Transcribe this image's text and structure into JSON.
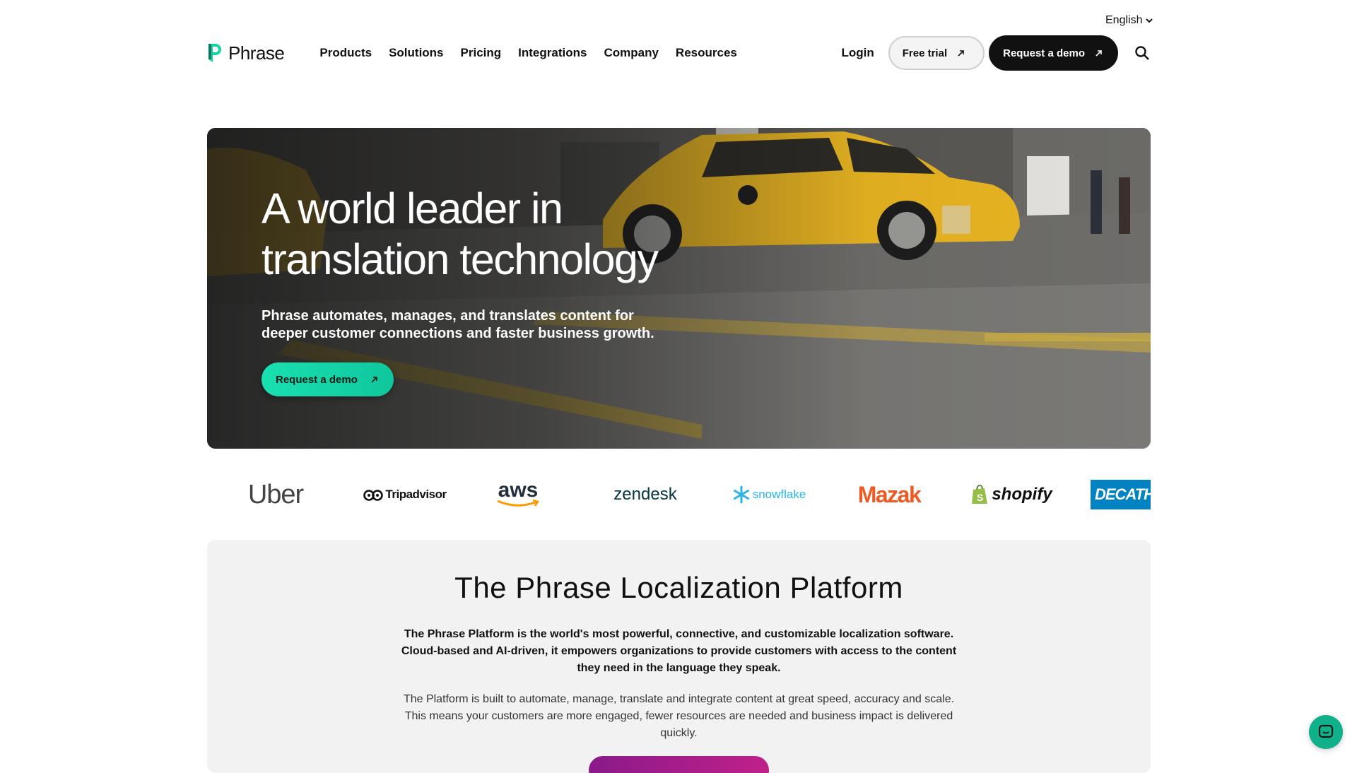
{
  "header": {
    "language": "English",
    "logo_text": "Phrase",
    "nav": [
      "Products",
      "Solutions",
      "Pricing",
      "Integrations",
      "Company",
      "Resources"
    ],
    "login": "Login",
    "free_trial": "Free trial",
    "request_demo": "Request a demo"
  },
  "hero": {
    "title_line1": "A world leader in",
    "title_line2": "translation technology",
    "subtitle_line1": "Phrase automates, manages, and translates content for",
    "subtitle_line2": "deeper customer connections and faster business growth.",
    "cta": "Request a demo"
  },
  "logos": {
    "uber": "Uber",
    "tripadvisor": "Tripadvisor",
    "aws": "aws",
    "zendesk": "zendesk",
    "snowflake": "snowflake",
    "mazak": "Mazak",
    "shopify": "shopify",
    "decathlon": "DECATH"
  },
  "platform": {
    "title": "The Phrase Localization Platform",
    "lead": "The Phrase Platform is the world's most powerful, connective, and customizable localization software. Cloud-based and AI-driven, it empowers organizations to provide customers with access to the content they need in the language they speak.",
    "body": "The Platform is built to automate, manage, translate and integrate content at great speed, accuracy and scale. This means your customers are more engaged, fewer resources are needed and business impact is delivered quickly."
  },
  "colors": {
    "accent_green": "#19e0b1",
    "dark": "#111111",
    "taxi_yellow": "#e9b521"
  }
}
